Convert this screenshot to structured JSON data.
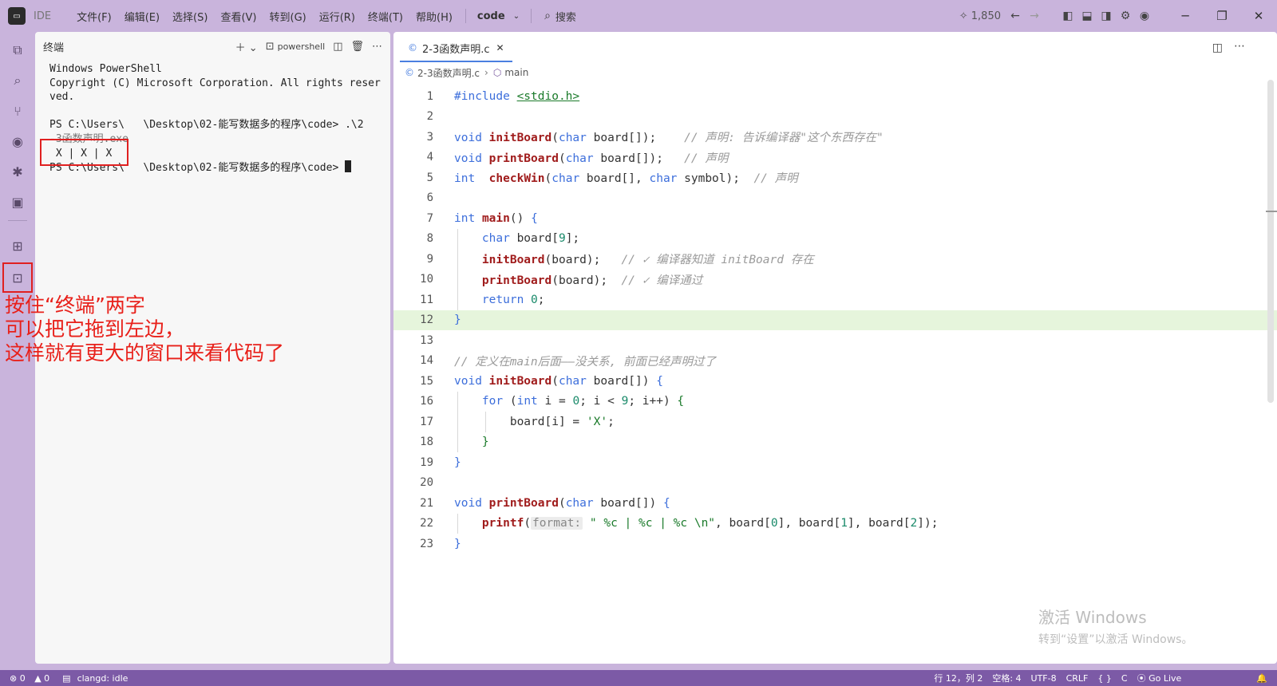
{
  "titlebar": {
    "app_logo": "IDE",
    "app_name": "IDE",
    "menu": [
      "文件(F)",
      "编辑(E)",
      "选择(S)",
      "查看(V)",
      "转到(G)",
      "运行(R)",
      "终端(T)",
      "帮助(H)"
    ],
    "project": "code",
    "search_label": "搜索",
    "credits": "1,850"
  },
  "terminal": {
    "title": "终端",
    "shell": "powershell",
    "lines": [
      "Windows PowerShell",
      "Copyright (C) Microsoft Corporation. All rights reser",
      "ved.",
      "",
      "PS C:\\Users\\   \\Desktop\\02-能写数据多的程序\\code> .\\2"
    ],
    "exe_line": "-3函数声明.exe",
    "output_line": " X | X | X",
    "prompt_line": "PS C:\\Users\\   \\Desktop\\02-能写数据多的程序\\code> "
  },
  "editor": {
    "tab_label": "2-3函数声明.c",
    "breadcrumb_file": "2-3函数声明.c",
    "breadcrumb_symbol": "main",
    "current_line": 12
  },
  "annotation": {
    "line1": "按住“终端”两字",
    "line2": "可以把它拖到左边，",
    "line3": "这样就有更大的窗口来看代码了"
  },
  "watermark": {
    "line1": "激活 Windows",
    "line2": "转到“设置”以激活 Windows。"
  },
  "statusbar": {
    "errors": "0",
    "warnings": "0",
    "lsp": "clangd: idle",
    "position": "行 12，列 2",
    "indent": "空格: 4",
    "encoding": "UTF-8",
    "eol": "CRLF",
    "braces": "{ }",
    "language": "C",
    "golive": "Go Live"
  }
}
